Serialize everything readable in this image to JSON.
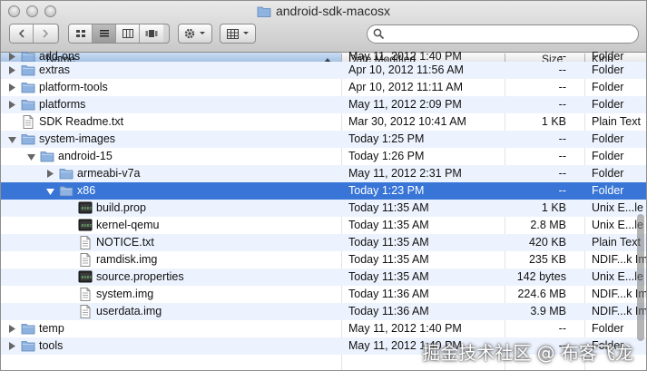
{
  "window": {
    "title": "android-sdk-macosx"
  },
  "toolbar": {
    "back_icon": "chevron-left-icon",
    "forward_icon": "chevron-right-icon",
    "view_modes": [
      "icon-view-icon",
      "list-view-icon",
      "column-view-icon",
      "coverflow-view-icon"
    ],
    "active_view": "list-view-icon",
    "action_icon": "gear-icon",
    "arrange_icon": "grid-icon",
    "search_value": ""
  },
  "columns": {
    "name": "Name",
    "date": "Date Modified",
    "size": "Size",
    "kind": "Kind"
  },
  "rows": [
    {
      "name": "add-ons",
      "date": "May 11, 2012 1:40 PM",
      "size": "--",
      "kind": "Folder",
      "icon": "folder",
      "indent": 0,
      "expander": "closed",
      "partial": true
    },
    {
      "name": "extras",
      "date": "Apr 10, 2012 11:56 AM",
      "size": "--",
      "kind": "Folder",
      "icon": "folder",
      "indent": 0,
      "expander": "closed"
    },
    {
      "name": "platform-tools",
      "date": "Apr 10, 2012 11:11 AM",
      "size": "--",
      "kind": "Folder",
      "icon": "folder",
      "indent": 0,
      "expander": "closed"
    },
    {
      "name": "platforms",
      "date": "May 11, 2012 2:09 PM",
      "size": "--",
      "kind": "Folder",
      "icon": "folder",
      "indent": 0,
      "expander": "closed"
    },
    {
      "name": "SDK Readme.txt",
      "date": "Mar 30, 2012 10:41 AM",
      "size": "1 KB",
      "kind": "Plain Text",
      "icon": "doc",
      "indent": 0,
      "expander": "none"
    },
    {
      "name": "system-images",
      "date": "Today 1:25 PM",
      "size": "--",
      "kind": "Folder",
      "icon": "folder",
      "indent": 0,
      "expander": "open"
    },
    {
      "name": "android-15",
      "date": "Today 1:26 PM",
      "size": "--",
      "kind": "Folder",
      "icon": "folder",
      "indent": 1,
      "expander": "open"
    },
    {
      "name": "armeabi-v7a",
      "date": "May 11, 2012 2:31 PM",
      "size": "--",
      "kind": "Folder",
      "icon": "folder",
      "indent": 2,
      "expander": "closed"
    },
    {
      "name": "x86",
      "date": "Today 1:23 PM",
      "size": "--",
      "kind": "Folder",
      "icon": "folder",
      "indent": 2,
      "expander": "open",
      "selected": true
    },
    {
      "name": "build.prop",
      "date": "Today 11:35 AM",
      "size": "1 KB",
      "kind": "Unix E...le",
      "icon": "exec",
      "indent": 3,
      "expander": "none"
    },
    {
      "name": "kernel-qemu",
      "date": "Today 11:35 AM",
      "size": "2.8 MB",
      "kind": "Unix E...le",
      "icon": "exec",
      "indent": 3,
      "expander": "none"
    },
    {
      "name": "NOTICE.txt",
      "date": "Today 11:35 AM",
      "size": "420 KB",
      "kind": "Plain Text",
      "icon": "doc",
      "indent": 3,
      "expander": "none"
    },
    {
      "name": "ramdisk.img",
      "date": "Today 11:35 AM",
      "size": "235 KB",
      "kind": "NDIF...k Image",
      "icon": "doc",
      "indent": 3,
      "expander": "none"
    },
    {
      "name": "source.properties",
      "date": "Today 11:35 AM",
      "size": "142 bytes",
      "kind": "Unix E...le",
      "icon": "exec",
      "indent": 3,
      "expander": "none"
    },
    {
      "name": "system.img",
      "date": "Today 11:36 AM",
      "size": "224.6 MB",
      "kind": "NDIF...k Image",
      "icon": "doc",
      "indent": 3,
      "expander": "none"
    },
    {
      "name": "userdata.img",
      "date": "Today 11:36 AM",
      "size": "3.9 MB",
      "kind": "NDIF...k Image",
      "icon": "doc",
      "indent": 3,
      "expander": "none"
    },
    {
      "name": "temp",
      "date": "May 11, 2012 1:40 PM",
      "size": "--",
      "kind": "Folder",
      "icon": "folder",
      "indent": 0,
      "expander": "closed"
    },
    {
      "name": "tools",
      "date": "May 11, 2012 1:40 PM",
      "size": "--",
      "kind": "Folder",
      "icon": "folder",
      "indent": 0,
      "expander": "closed"
    }
  ],
  "watermark": "掘金技术社区 @ 布客飞龙",
  "colors": {
    "selection": "#3875d7",
    "alt_row": "#edf3fe",
    "folder": "#8fb3e0"
  }
}
